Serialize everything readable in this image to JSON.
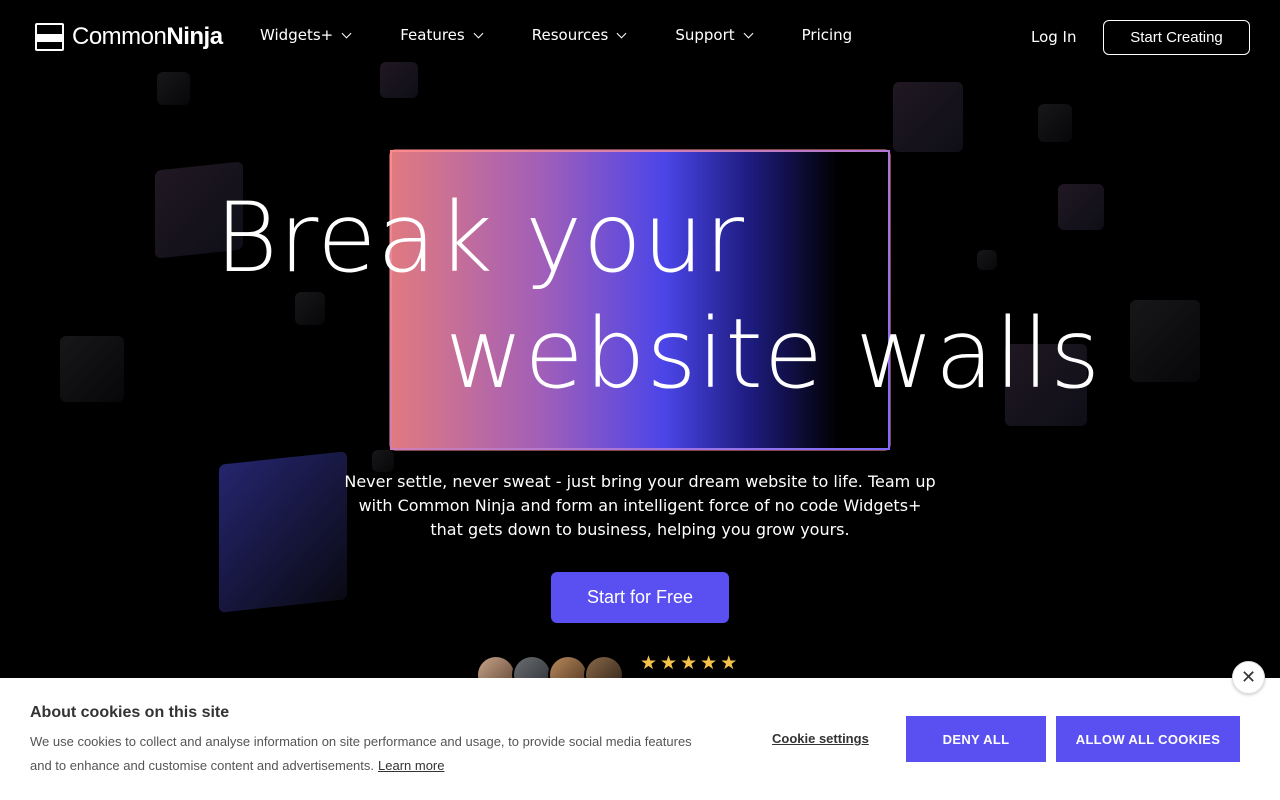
{
  "header": {
    "logo_light": "Common",
    "logo_bold": "Ninja",
    "nav": [
      {
        "label": "Widgets+",
        "has_dropdown": true
      },
      {
        "label": "Features",
        "has_dropdown": true
      },
      {
        "label": "Resources",
        "has_dropdown": true
      },
      {
        "label": "Support",
        "has_dropdown": true
      },
      {
        "label": "Pricing",
        "has_dropdown": false
      }
    ],
    "login_label": "Log In",
    "start_creating_label": "Start Creating"
  },
  "hero": {
    "headline_line1": "Break your",
    "headline_line2": "website walls",
    "subtext": "Never settle, never sweat - just bring your dream website to life. Team up with Common Ninja and form an intelligent force of no code Widgets+ that gets down to business, helping you grow yours.",
    "cta_label": "Start for Free",
    "rating_stars": 5,
    "star_glyph": "★"
  },
  "cookie_banner": {
    "title": "About cookies on this site",
    "description": "We use cookies to collect and analyse information on site performance and usage, to provide social media features and to enhance and customise content and advertisements.",
    "learn_more": "Learn more",
    "settings_label": "Cookie settings",
    "deny_label": "DENY ALL",
    "allow_label": "ALLOW ALL COOKIES",
    "close_glyph": "✕"
  },
  "colors": {
    "accent": "#5a4ff0",
    "star": "#f5c34a",
    "background": "#000000"
  }
}
